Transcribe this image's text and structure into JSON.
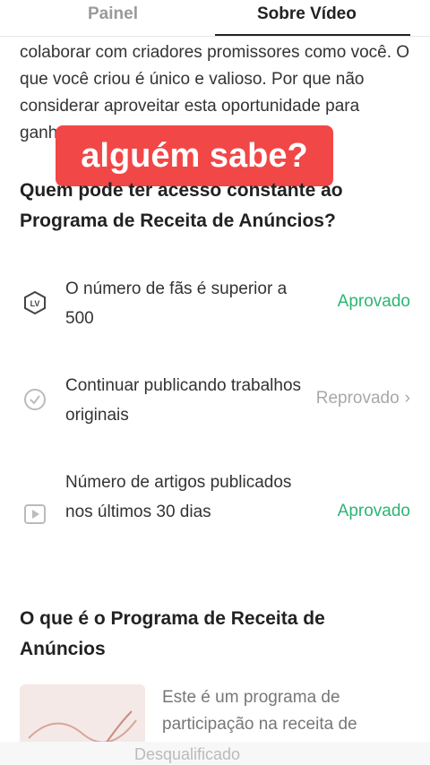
{
  "tabs": {
    "painel": "Painel",
    "sobre": "Sobre Vídeo"
  },
  "intro_text": "colaborar com criadores promissores como você. O que você criou é único e valioso. Por que não considerar aproveitar esta oportunidade para ganhar uma renda extra?",
  "caption": "alguém sabe?",
  "section1_title": "Quem pode ter acesso constante ao Programa de Receita de Anúncios?",
  "requirements": [
    {
      "text": "O número de fãs é superior a 500",
      "status": "Aprovado",
      "icon": "lv-badge-icon"
    },
    {
      "text": "Continuar publicando trabalhos originais",
      "status": "Reprovado",
      "icon": "original-icon"
    },
    {
      "text": "Número de artigos publicados nos últimos 30 dias",
      "status": "Aprovado",
      "icon": "video-icon"
    }
  ],
  "section2_title": "O que é o Programa de Receita de Anúncios",
  "program_desc": "Este é um programa de participação na receita de",
  "bottom_label": "Desqualificado",
  "colors": {
    "approved": "#2bb673",
    "rejected": "#a8a8a8",
    "caption_bg": "#f24747"
  }
}
